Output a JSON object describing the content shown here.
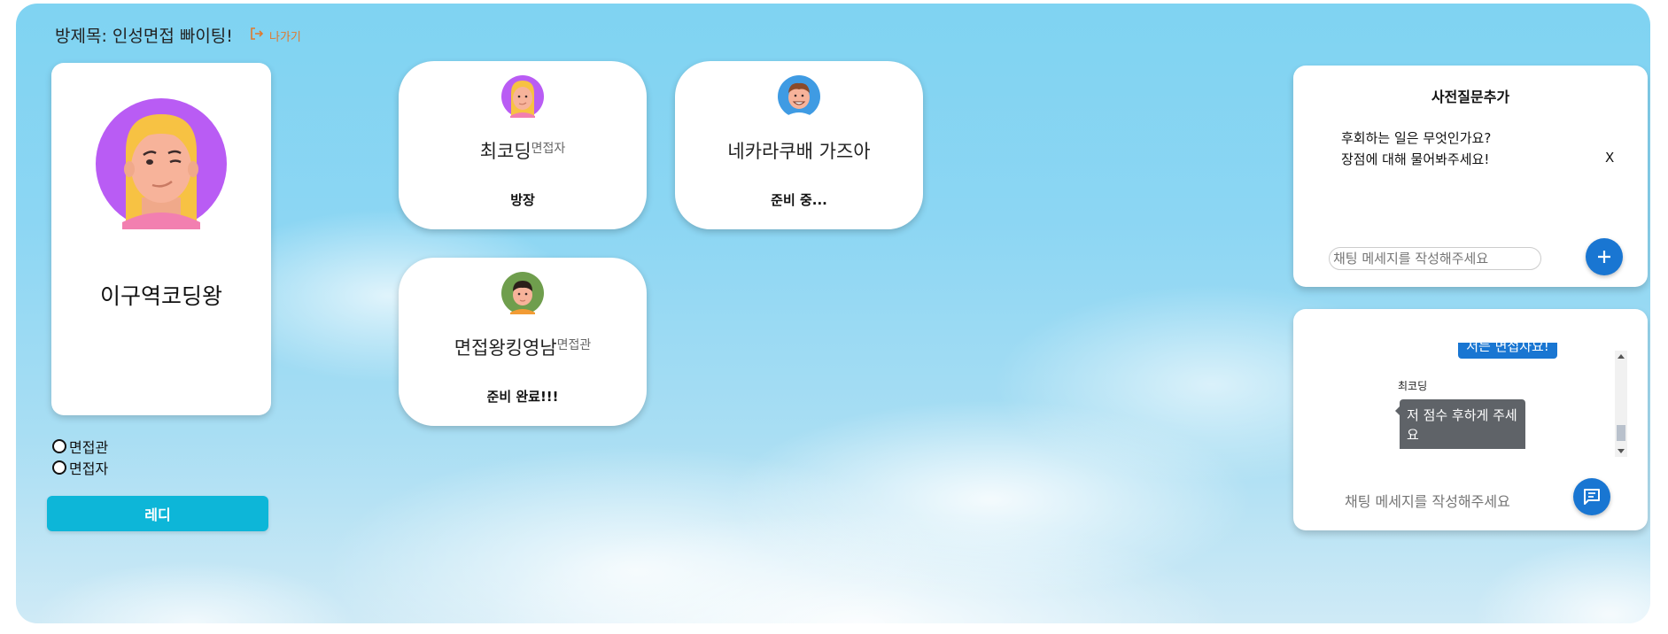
{
  "header": {
    "room_title": "방제목: 인성면접 빠이팅!",
    "exit_label": "나가기",
    "exit_color": "#e0792d"
  },
  "me": {
    "name": "이구역코딩왕",
    "avatar_icon": "avatar-woman-icon",
    "roles": [
      "면접관",
      "면접자"
    ],
    "ready_label": "레디",
    "ready_color": "#0db6d8"
  },
  "participants": [
    {
      "name": "최코딩",
      "role": "면접자",
      "status": "방장",
      "avatar_icon": "avatar-woman-icon"
    },
    {
      "name": "네카라쿠배 가즈아",
      "role": "",
      "status": "준비 중...",
      "avatar_icon": "avatar-man-icon"
    },
    {
      "name": "면접왕킹영남",
      "role": "면접관",
      "status": "준비 완료!!!",
      "avatar_icon": "avatar-boy-icon"
    }
  ],
  "questions_panel": {
    "title": "사전질문추가",
    "items": [
      "후회하는 일은 무엇인가요?",
      "장점에 대해 물어봐주세요!"
    ],
    "remove_label": "X",
    "input_placeholder": "채팅 메세지를 작성해주세요",
    "add_icon": "plus-icon"
  },
  "chat_panel": {
    "messages": [
      {
        "sender": "",
        "text": "저는 면접자요!",
        "mine": true
      },
      {
        "sender": "최코딩",
        "text": "저 점수 후하게 주세요",
        "mine": false
      }
    ],
    "input_placeholder": "채팅 메세지를 작성해주세요",
    "send_icon": "chat-icon",
    "accent": "#1976d2"
  }
}
